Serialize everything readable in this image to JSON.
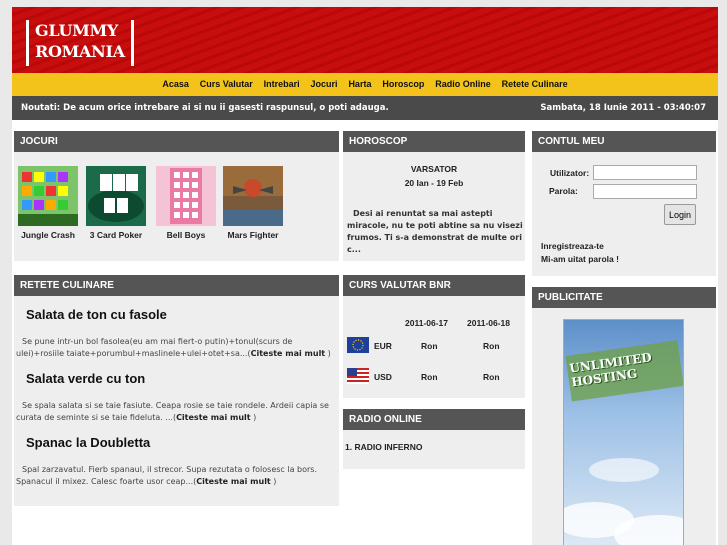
{
  "logo": {
    "line1": "GLUMMY",
    "line2": "ROMANIA"
  },
  "nav": [
    "Acasa",
    "Curs Valutar",
    "Intrebari",
    "Jocuri",
    "Harta",
    "Horoscop",
    "Radio Online",
    "Retete Culinare"
  ],
  "news": {
    "text": "Noutati: De acum orice intrebare ai si nu ii gasesti raspunsul, o poti adauga.",
    "datetime": "Sambata, 18 Iunie 2011 - 03:40:07"
  },
  "jocuri": {
    "title": "JOCURI",
    "games": [
      "Jungle Crash",
      "3 Card Poker",
      "Bell Boys",
      "Mars Fighter"
    ]
  },
  "horoscop": {
    "title": "HOROSCOP",
    "sign": "VARSATOR",
    "dates": "20 Ian - 19 Feb",
    "text": "Desi ai renuntat sa mai astepti miracole, nu te poti abtine sa nu visezi frumos. Ti s-a demonstrat de multe ori c..."
  },
  "contul": {
    "title": "CONTUL MEU",
    "user_label": "Utilizator:",
    "pass_label": "Parola:",
    "login": "Login",
    "register": "Inregistreaza-te",
    "forgot": "Mi-am uitat parola !"
  },
  "retete": {
    "title": "RETETE CULINARE",
    "more": "Citeste mai mult",
    "items": [
      {
        "title": "Salata de ton cu fasole",
        "text": "Se pune intr-un bol fasolea(eu am mai fiert-o putin)+tonul(scurs de ulei)+rosiile taiate+porumbul+maslinele+ulei+otet+sa...("
      },
      {
        "title": "Salata verde cu ton",
        "text": "Se spala salata si se taie fasiute. Ceapa rosie se taie rondele. Ardeii capia se curata de seminte si se taie fideluta. ...("
      },
      {
        "title": "Spanac la Doubletta",
        "text": "Spal zarzavatul. Fierb spanaul, il strecor. Supa rezutata o folosesc la bors. Spanacul il mixez. Calesc foarte usor ceap...("
      }
    ]
  },
  "curs": {
    "title": "CURS VALUTAR BNR",
    "dates": [
      "2011-06-17",
      "2011-06-18"
    ],
    "rows": [
      {
        "code": "EUR",
        "v1": "Ron",
        "v2": "Ron"
      },
      {
        "code": "USD",
        "v1": "Ron",
        "v2": "Ron"
      }
    ]
  },
  "radio": {
    "title": "RADIO ONLINE",
    "item": "1. RADIO INFERNO"
  },
  "publicitate": {
    "title": "PUBLICITATE",
    "banner": "UNLIMITED HOSTING"
  },
  "colors": {
    "header_red": "#c70d0d",
    "nav_yellow": "#f3c21b",
    "bar_gray": "#555555"
  }
}
